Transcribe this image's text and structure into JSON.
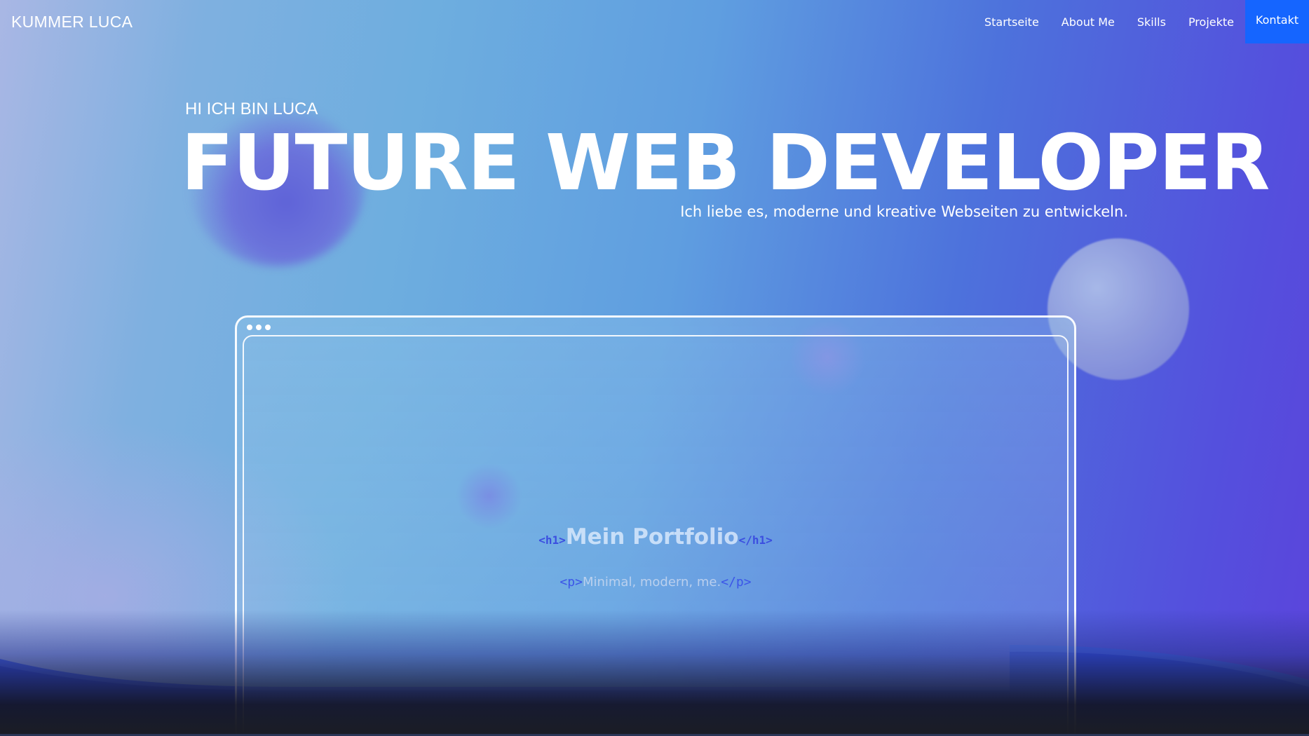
{
  "nav": {
    "logo": "KUMMER LUCA",
    "items": [
      {
        "label": "Startseite"
      },
      {
        "label": "About Me"
      },
      {
        "label": "Skills"
      },
      {
        "label": "Projekte"
      },
      {
        "label": "Kontakt"
      }
    ]
  },
  "hero": {
    "greeting": "HI ICH BIN LUCA",
    "headline": "FUTURE WEB DEVELOPER",
    "subline": "Ich liebe es, moderne und kreative Webseiten zu entwickeln."
  },
  "mockup": {
    "h1_open": "<h1>",
    "title": "Mein Portfolio",
    "h1_close": "</h1>",
    "p_open": "<p>",
    "text": "Minimal, modern, me.",
    "p_close": "</p>"
  },
  "colors": {
    "accent": "#1565ff",
    "tag": "#3b4ee0"
  }
}
